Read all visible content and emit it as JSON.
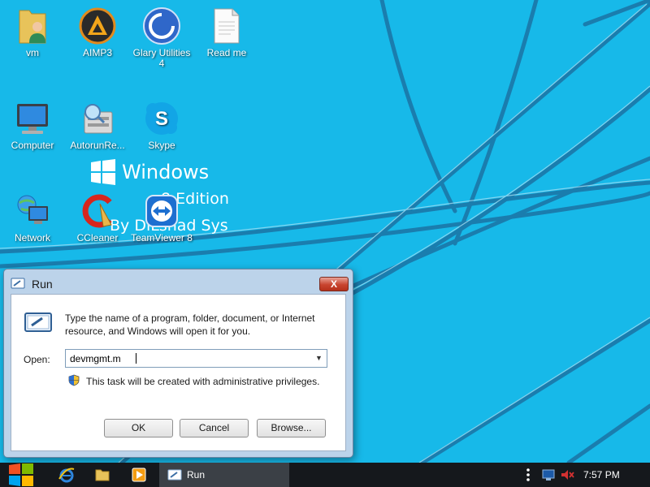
{
  "desktop": {
    "icons": [
      {
        "label": "vm",
        "icon": "user-folder-icon"
      },
      {
        "label": "AIMP3",
        "icon": "aimp3-icon"
      },
      {
        "label": "Glary Utilities 4",
        "icon": "glary-utilities-icon"
      },
      {
        "label": "Read me",
        "icon": "text-document-icon"
      },
      {
        "label": "Computer",
        "icon": "computer-icon"
      },
      {
        "label": "AutorunRe...",
        "icon": "autorun-icon"
      },
      {
        "label": "Skype",
        "icon": "skype-icon"
      },
      {
        "label": "Network",
        "icon": "network-icon"
      },
      {
        "label": "CCleaner",
        "icon": "ccleaner-icon"
      },
      {
        "label": "TeamViewer 8",
        "icon": "teamviewer-icon"
      }
    ],
    "wallpaper": {
      "brand_line1": "Windows",
      "brand_line2": "8 Edition",
      "brand_line3": "By DiLshad Sys"
    }
  },
  "run_dialog": {
    "title": "Run",
    "close_label": "X",
    "description": "Type the name of a program, folder, document, or Internet resource, and Windows will open it for you.",
    "open_label": "Open:",
    "open_value": "devmgmt.m",
    "admin_note": "This task will be created with administrative privileges.",
    "buttons": {
      "ok": "OK",
      "cancel": "Cancel",
      "browse": "Browse..."
    }
  },
  "taskbar": {
    "start_icon": "windows-logo-icon",
    "pinned": [
      "internet-explorer-icon",
      "file-explorer-icon",
      "media-player-icon"
    ],
    "open_window": "Run",
    "tray_icons": [
      "overflow-dots-icon",
      "network-status-icon",
      "volume-muted-icon"
    ],
    "clock": "7:57 PM"
  },
  "colors": {
    "desktop_bg": "#17b9e9",
    "wallpaper_stripe": "#1a7cae",
    "taskbar_bg": "#15181c",
    "dialog_frame": "#bcd3ea",
    "close_button": "#c8442f"
  }
}
